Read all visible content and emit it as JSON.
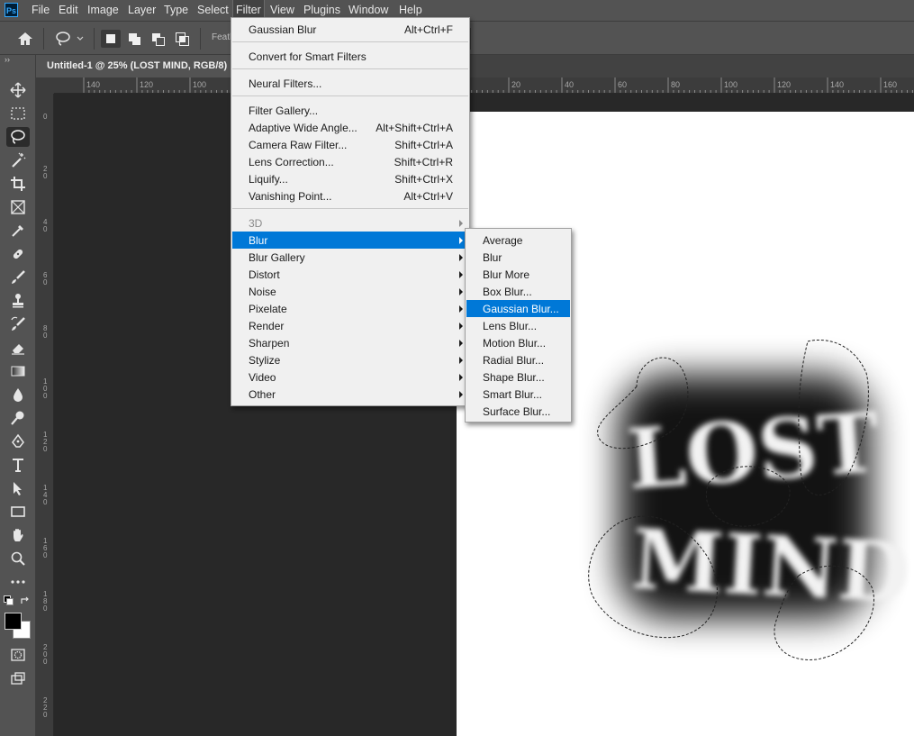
{
  "app": {
    "logo": "Ps"
  },
  "menubar": [
    "File",
    "Edit",
    "Image",
    "Layer",
    "Type",
    "Select",
    "Filter",
    "View",
    "Plugins",
    "Window",
    "Help"
  ],
  "options": {
    "feather_label": "Feath"
  },
  "document": {
    "tab_title": "Untitled-1 @ 25% (LOST MIND, RGB/8)"
  },
  "rulers": {
    "h_labels": [
      "140",
      "120",
      "100",
      "20",
      "40",
      "60",
      "80",
      "100",
      "120",
      "140",
      "160"
    ],
    "v_labels": [
      "0",
      "2 0",
      "4 0",
      "6 0",
      "8 0",
      "1 0 0",
      "1 2 0",
      "1 4 0",
      "1 6 0",
      "1 8 0",
      "2 0 0",
      "2 2 0"
    ]
  },
  "artwork": {
    "line1": "LOST",
    "line2": "MIND"
  },
  "filter_menu": {
    "items": [
      {
        "label": "Gaussian Blur",
        "shortcut": "Alt+Ctrl+F"
      },
      {
        "label": "Convert for Smart Filters"
      },
      {
        "label": "Neural Filters..."
      },
      {
        "label": "Filter Gallery..."
      },
      {
        "label": "Adaptive Wide Angle...",
        "shortcut": "Alt+Shift+Ctrl+A"
      },
      {
        "label": "Camera Raw Filter...",
        "shortcut": "Shift+Ctrl+A"
      },
      {
        "label": "Lens Correction...",
        "shortcut": "Shift+Ctrl+R"
      },
      {
        "label": "Liquify...",
        "shortcut": "Shift+Ctrl+X"
      },
      {
        "label": "Vanishing Point...",
        "shortcut": "Alt+Ctrl+V"
      },
      {
        "label": "3D"
      },
      {
        "label": "Blur"
      },
      {
        "label": "Blur Gallery"
      },
      {
        "label": "Distort"
      },
      {
        "label": "Noise"
      },
      {
        "label": "Pixelate"
      },
      {
        "label": "Render"
      },
      {
        "label": "Sharpen"
      },
      {
        "label": "Stylize"
      },
      {
        "label": "Video"
      },
      {
        "label": "Other"
      }
    ]
  },
  "blur_submenu": {
    "items": [
      "Average",
      "Blur",
      "Blur More",
      "Box Blur...",
      "Gaussian Blur...",
      "Lens Blur...",
      "Motion Blur...",
      "Radial Blur...",
      "Shape Blur...",
      "Smart Blur...",
      "Surface Blur..."
    ]
  },
  "colors": {
    "highlight": "#0078d7",
    "menu_bg": "#f0f0f0",
    "ui_panel": "#535353",
    "canvas": "#ffffff"
  }
}
